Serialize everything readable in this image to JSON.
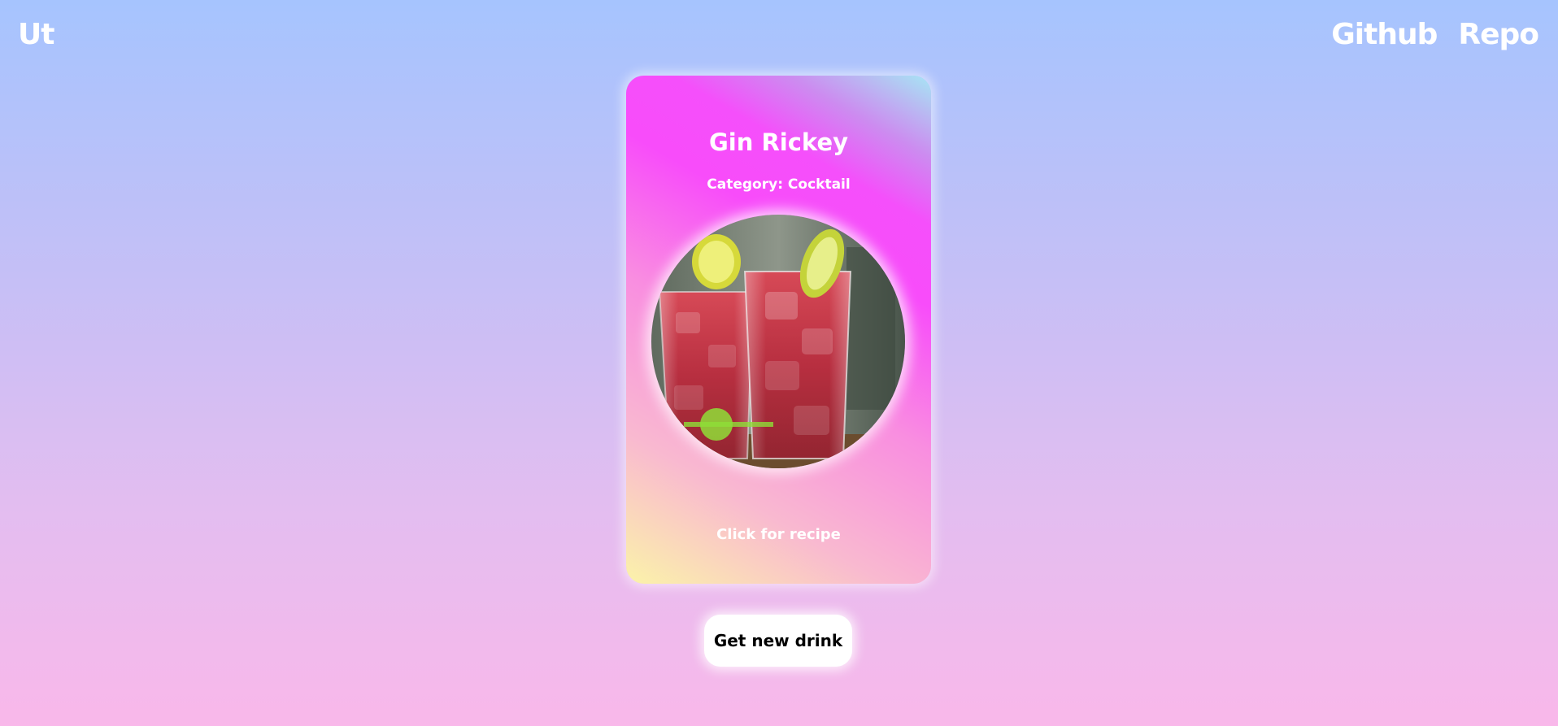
{
  "header": {
    "logo": "Ut",
    "nav": [
      {
        "label": "Github"
      },
      {
        "label": "Repo"
      }
    ]
  },
  "card": {
    "title": "Gin Rickey",
    "category": "Category: Cocktail",
    "image_alt": "Gin Rickey",
    "recipe_link": "Click for recipe"
  },
  "actions": {
    "new_drink_label": "Get new drink"
  },
  "colors": {
    "background_top": "#a6c4fe",
    "background_bottom": "#f9b8ea",
    "card_pink": "#f54ffb",
    "card_yellow": "#fbf3a9",
    "card_cyan": "#a6e6f4",
    "text": "#ffffff"
  }
}
